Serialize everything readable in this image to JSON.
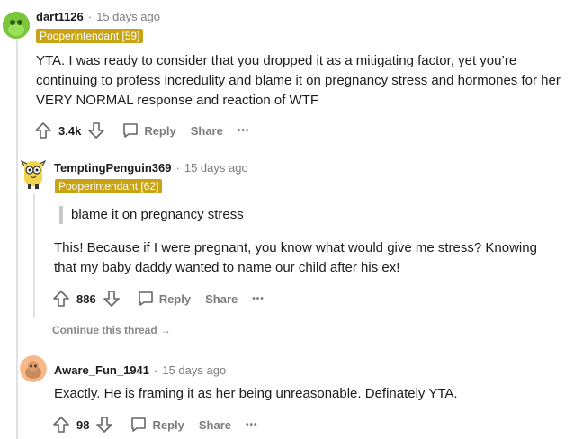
{
  "comments": [
    {
      "username": "dart1126",
      "separator": "·",
      "time": "15 days ago",
      "flair": "Pooperintendant [59]",
      "text": "YTA. I was ready to consider that you dropped it as a mitigating factor, yet you’re continuing to profess incredulity and blame it on pregnancy stress and hormones for her VERY NORMAL response and reaction of WTF",
      "votes": "3.4k",
      "reply": "Reply",
      "share": "Share",
      "more": "•••"
    },
    {
      "username": "TemptingPenguin369",
      "separator": "·",
      "time": "15 days ago",
      "flair": "Pooperintendant [62]",
      "quote": "blame it on pregnancy stress",
      "text": "This! Because if I were pregnant, you know what would give me stress? Knowing that my baby daddy wanted to name our child after his ex!",
      "votes": "886",
      "reply": "Reply",
      "share": "Share",
      "more": "•••",
      "continue": "Continue this thread →"
    },
    {
      "username": "Aware_Fun_1941",
      "separator": "·",
      "time": "15 days ago",
      "text": "Exactly. He is framing it as her being unreasonable. Definately YTA.",
      "votes": "98",
      "reply": "Reply",
      "share": "Share",
      "more": "•••"
    }
  ],
  "colors": {
    "flair_bg": "#c8a415",
    "muted_text": "#7c7c7c",
    "thread_line": "#e0e2e4"
  },
  "icons": [
    "snoo-avatar-green",
    "snoo-avatar-penguin",
    "snoo-avatar-orange",
    "upvote-icon",
    "downvote-icon",
    "comment-icon"
  ]
}
